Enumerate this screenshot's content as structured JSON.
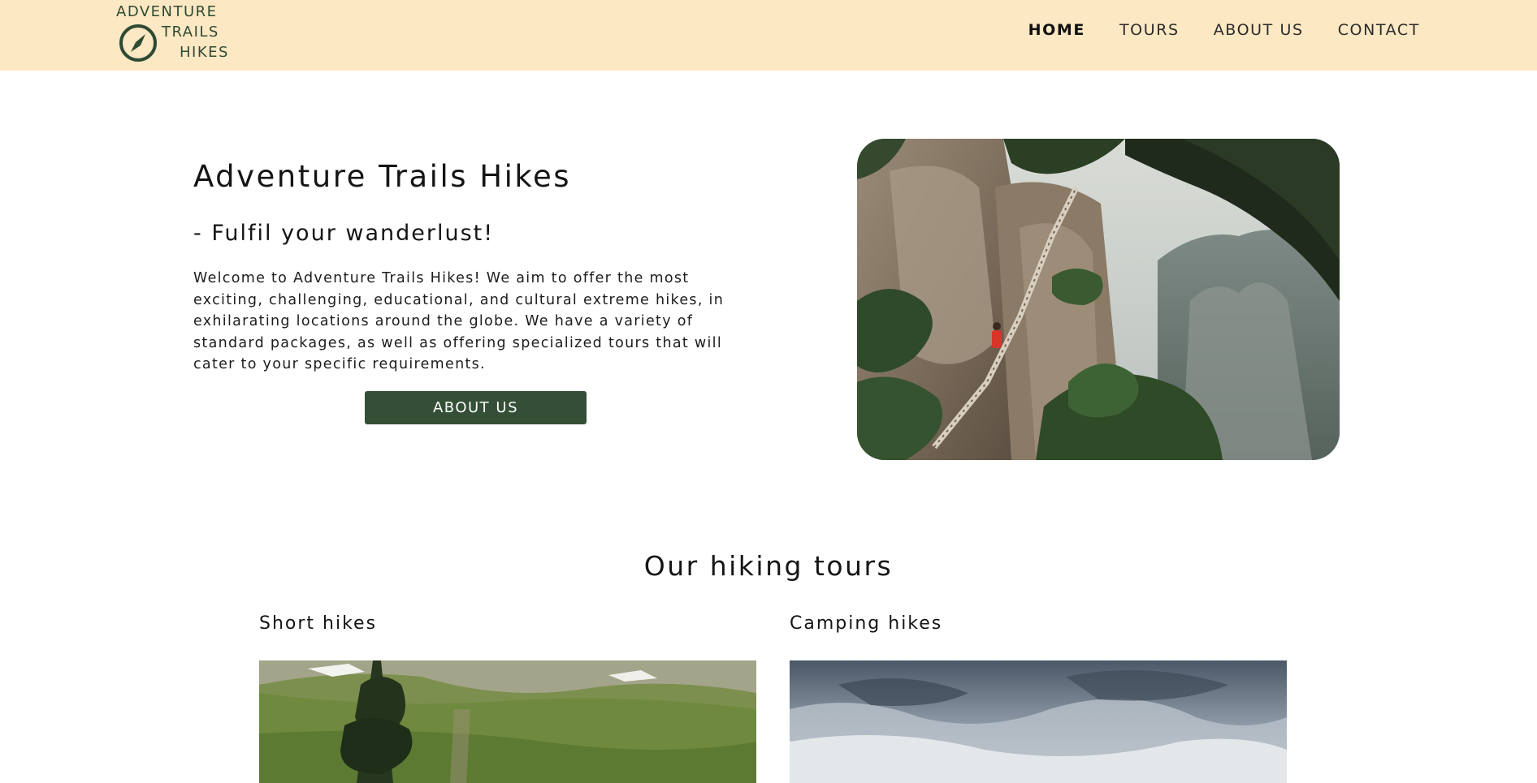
{
  "header": {
    "logo": {
      "line1": "ADVENTURE",
      "line2": "TRAILS",
      "line3": "HIKES",
      "icon": "compass-icon"
    },
    "nav": [
      {
        "label": "HOME",
        "active": true
      },
      {
        "label": "TOURS",
        "active": false
      },
      {
        "label": "ABOUT US",
        "active": false
      },
      {
        "label": "CONTACT",
        "active": false
      }
    ]
  },
  "hero": {
    "title": "Adventure Trails Hikes",
    "subtitle": "- Fulfil your wanderlust!",
    "text": "Welcome to Adventure Trails Hikes! We aim to offer the most exciting, challenging, educational, and cultural extreme hikes, in exhilarating locations around the globe. We have a variety of standard packages, as well as offering specialized tours that will cater to your specific requirements.",
    "button_label": "ABOUT US"
  },
  "tours": {
    "title": "Our hiking tours",
    "cards": [
      {
        "title": "Short hikes"
      },
      {
        "title": "Camping hikes"
      }
    ]
  },
  "colors": {
    "header_bg": "#fde8c4",
    "brand_green": "#344f36",
    "logo_green": "#2f4a33"
  }
}
